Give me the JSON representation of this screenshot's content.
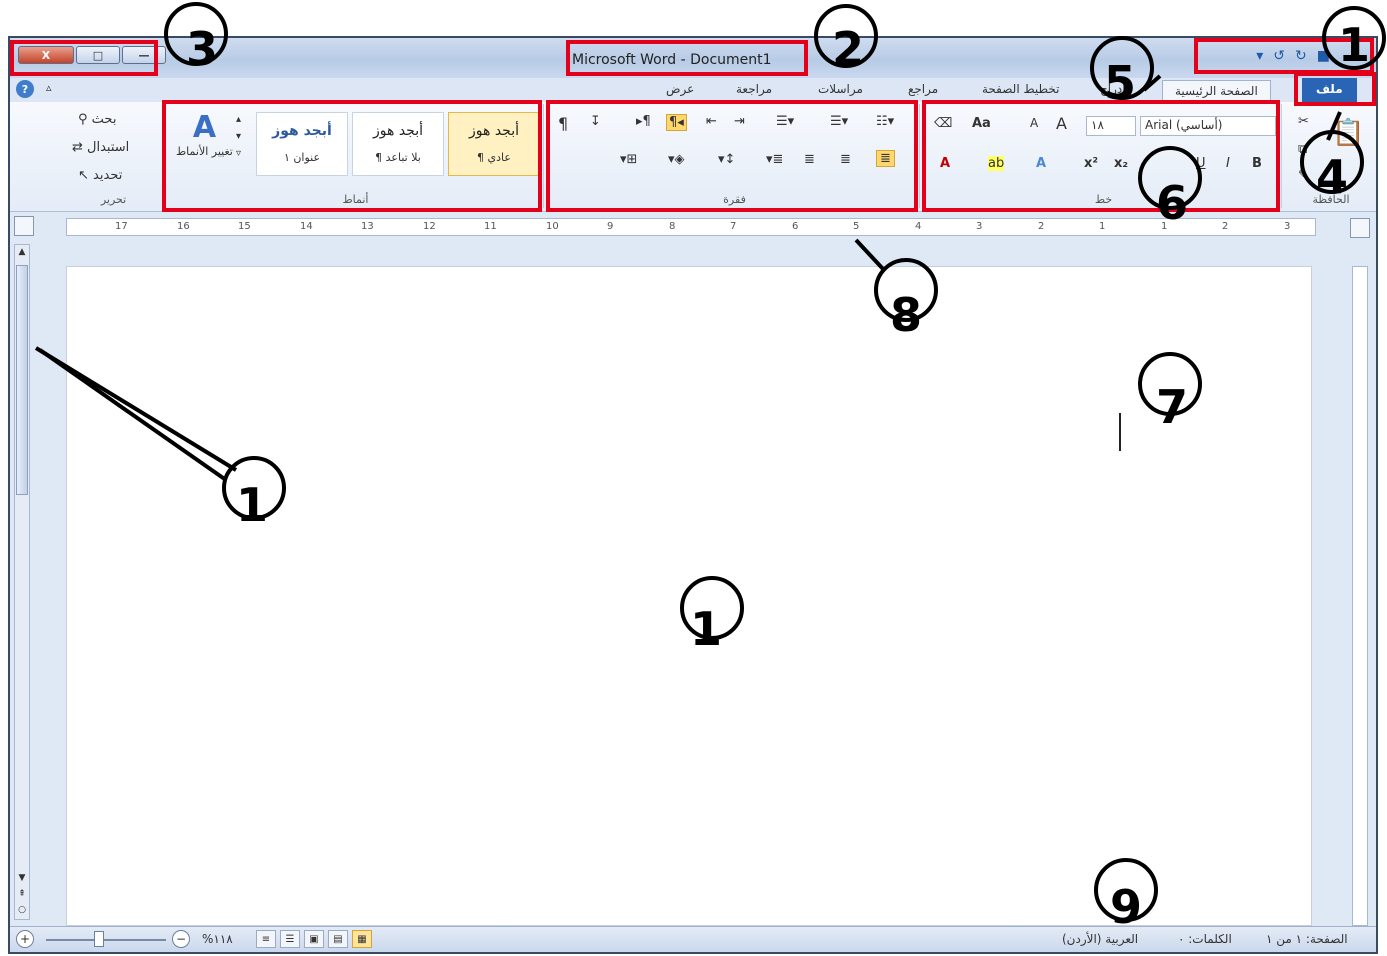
{
  "window": {
    "title": "Microsoft Word - Document1",
    "close_label": "X",
    "restore_label": "□",
    "minimize_label": "—",
    "qat_icons": [
      "customize-icon",
      "undo-icon",
      "redo-icon",
      "save-icon"
    ]
  },
  "tabs": {
    "file": "ملف",
    "home": "الصفحة الرئيسية",
    "insert": "إدراج",
    "layout": "تخطيط الصفحة",
    "references": "مراجع",
    "mailings": "مراسلات",
    "review": "مراجعة",
    "view": "عرض"
  },
  "ribbon": {
    "font": {
      "label": "خط",
      "font_name": "Arial (أساسي)",
      "font_size": "١٨",
      "grow": "A",
      "shrink": "A",
      "case": "Aa",
      "bold": "B",
      "italic": "I",
      "underline": "U",
      "superscript": "x²",
      "subscript": "x₂",
      "highlight": "ab",
      "color": "A"
    },
    "paragraph": {
      "label": "فقرة",
      "show_marks": "¶"
    },
    "styles": {
      "label": "أنماط",
      "items": [
        {
          "sample": "أبجد هوز",
          "name": "¶ عادي"
        },
        {
          "sample": "أبجد هوز",
          "name": "¶ بلا تباعد"
        },
        {
          "sample": "أبجد هوز",
          "name": "عنوان ١"
        }
      ],
      "change_styles": "تغيير الأنماط"
    },
    "editing": {
      "label": "تحرير",
      "find": "بحث",
      "replace": "استبدال",
      "select": "تحديد"
    },
    "clipboard": {
      "label": "الحافظة"
    }
  },
  "ruler": {
    "ticks": [
      "17",
      "16",
      "15",
      "14",
      "13",
      "12",
      "11",
      "10",
      "9",
      "8",
      "7",
      "6",
      "5",
      "4",
      "3",
      "2",
      "1",
      "1",
      "2",
      "3"
    ]
  },
  "status": {
    "page": "الصفحة: ١ من ١",
    "words": "الكلمات: ٠",
    "language": "العربية (الأردن)",
    "zoom": "%١١٨"
  },
  "annotations": {
    "labels": [
      "1",
      "2",
      "3",
      "4",
      "5",
      "6",
      "7",
      "8",
      "9",
      "1",
      "1"
    ]
  }
}
